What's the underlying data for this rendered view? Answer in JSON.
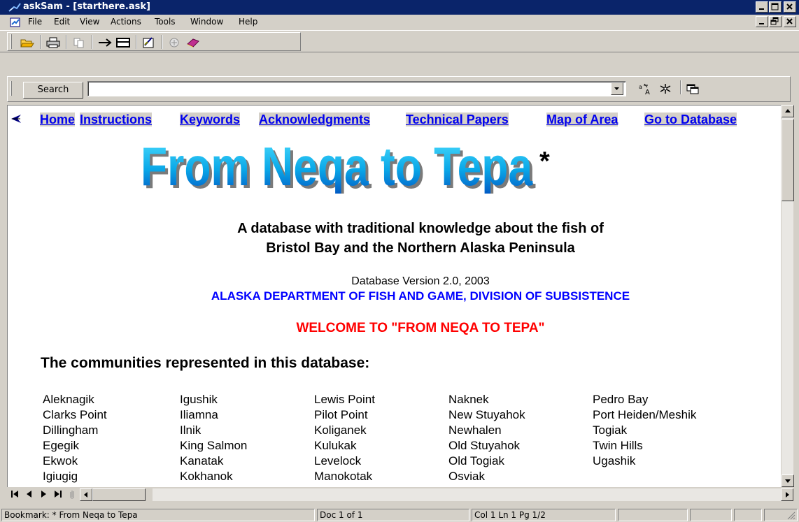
{
  "window": {
    "title": "askSam - [starthere.ask]"
  },
  "menu": [
    "File",
    "Edit",
    "View",
    "Actions",
    "Tools",
    "Window",
    "Help"
  ],
  "search": {
    "button_label": "Search",
    "value": ""
  },
  "nav_links": [
    "Home",
    "Instructions",
    "Keywords",
    "Acknowledgments",
    "Technical Papers",
    "Map of Area",
    "Go to Database"
  ],
  "page": {
    "banner": "From Neqa to Tepa",
    "banner_mark": "*",
    "subtitle_line1": "A database with traditional knowledge about the fish of",
    "subtitle_line2": "Bristol Bay and the Northern Alaska Peninsula",
    "version": "Database Version 2.0, 2003",
    "department": "ALASKA DEPARTMENT OF FISH AND GAME, DIVISION OF SUBSISTENCE",
    "welcome": "WELCOME TO \"FROM NEQA TO TEPA\"",
    "communities_heading": "The communities represented in this database:"
  },
  "communities": [
    [
      "Aleknagik",
      "Clarks Point",
      "Dillingham",
      "Egegik",
      "Ekwok",
      "Igiugig"
    ],
    [
      "Igushik",
      "Iliamna",
      "Ilnik",
      "King Salmon",
      "Kanatak",
      "Kokhanok"
    ],
    [
      "Lewis Point",
      "Pilot Point",
      "Koliganek",
      "Kulukak",
      "Levelock",
      "Manokotak"
    ],
    [
      "Naknek",
      "New Stuyahok",
      "Newhalen",
      "Old Stuyahok",
      "Old Togiak",
      "Osviak"
    ],
    [
      "Pedro Bay",
      "Port Heiden/Meshik",
      "Togiak",
      "Twin Hills",
      "Ugashik"
    ]
  ],
  "status": {
    "bookmark": "Bookmark: *  From Neqa to Tepa",
    "doc": "Doc 1 of 1",
    "position": "Col 1   Ln 1   Pg 1/2"
  },
  "colors": {
    "title_bar": "#0a246a",
    "link": "#0000ee",
    "department": "#0000ff",
    "welcome": "#ff0000",
    "chrome": "#d4d0c8"
  },
  "icons": [
    "app-icon",
    "document-icon",
    "open-folder-icon",
    "print-icon",
    "copy-icon",
    "arrow-right-icon",
    "form-view-icon",
    "report-icon",
    "wizard-icon",
    "book-icon",
    "dropdown-icon",
    "font-icon",
    "snowflake-icon",
    "window-icon",
    "bookmark-arrow-icon"
  ]
}
